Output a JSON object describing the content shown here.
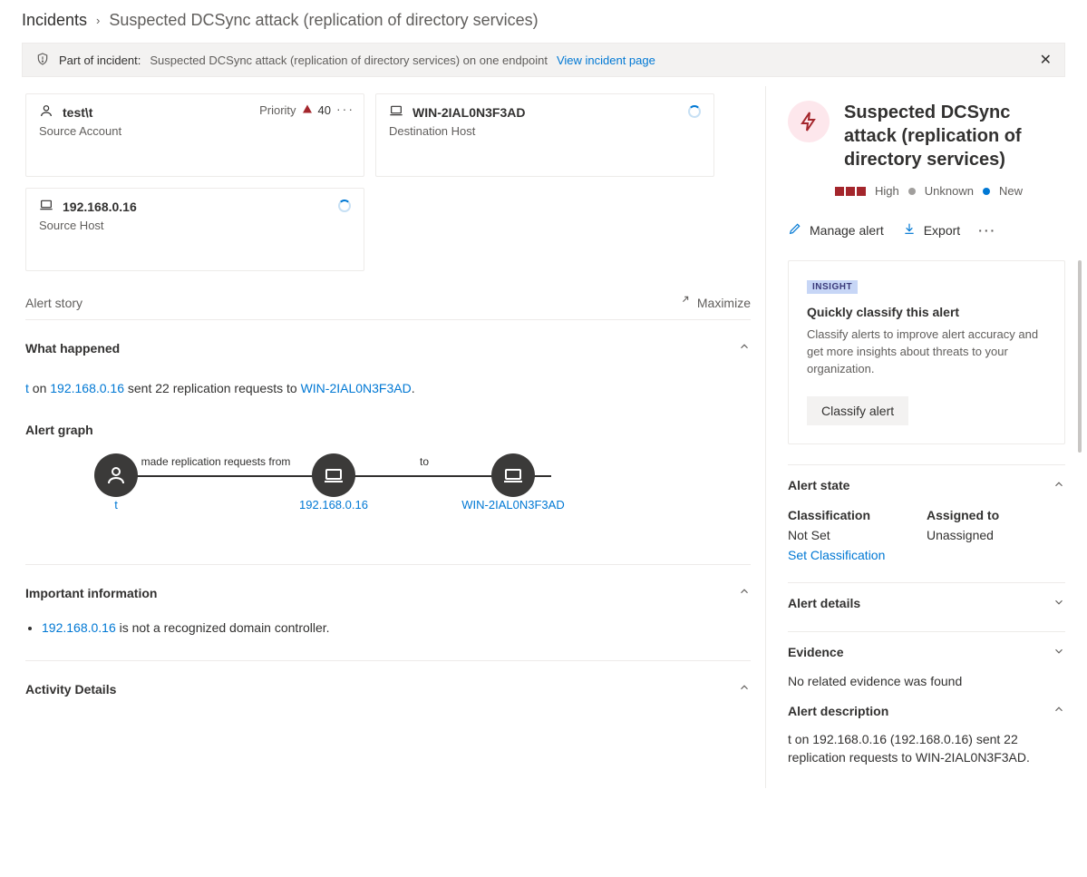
{
  "breadcrumb": {
    "root": "Incidents",
    "leaf": "Suspected DCSync attack (replication of directory services)"
  },
  "banner": {
    "prefix": "Part of incident:",
    "body": "Suspected DCSync attack (replication of directory services) on one endpoint",
    "link": "View incident page"
  },
  "cards": {
    "source_account": {
      "title": "test\\t",
      "subtitle": "Source Account",
      "priority_label": "Priority",
      "priority_value": "40"
    },
    "dest_host": {
      "title": "WIN-2IAL0N3F3AD",
      "subtitle": "Destination Host"
    },
    "source_host": {
      "title": "192.168.0.16",
      "subtitle": "Source Host"
    }
  },
  "alert_story": {
    "title": "Alert story",
    "maximize": "Maximize"
  },
  "what_happened": {
    "title": "What happened",
    "stmt": {
      "t1": "t",
      "t2": " on ",
      "ip": "192.168.0.16",
      "t3": " sent 22 replication requests to ",
      "host": "WIN-2IAL0N3F3AD",
      "t4": "."
    }
  },
  "alert_graph": {
    "title": "Alert graph",
    "nodes": {
      "n1": "t",
      "n2": "192.168.0.16",
      "n3": "WIN-2IAL0N3F3AD"
    },
    "edges": {
      "e1": "made replication requests from",
      "e2": "to"
    }
  },
  "important": {
    "title": "Important information",
    "items": [
      {
        "link": "192.168.0.16",
        "text": " is not a recognized domain controller."
      }
    ]
  },
  "activity_details": {
    "title": "Activity Details"
  },
  "side": {
    "title": "Suspected DCSync attack (replication of directory services)",
    "severity": "High",
    "state1": "Unknown",
    "state2": "New",
    "actions": {
      "manage": "Manage alert",
      "export": "Export"
    },
    "insight": {
      "tag": "INSIGHT",
      "title": "Quickly classify this alert",
      "body": "Classify alerts to improve alert accuracy and get more insights about threats to your organization.",
      "btn": "Classify alert"
    },
    "alert_state": {
      "title": "Alert state",
      "classification_label": "Classification",
      "classification_value": "Not Set",
      "set_link": "Set Classification",
      "assigned_label": "Assigned to",
      "assigned_value": "Unassigned"
    },
    "alert_details": {
      "title": "Alert details"
    },
    "evidence": {
      "title": "Evidence",
      "body": "No related evidence was found"
    },
    "alert_description": {
      "title": "Alert description",
      "body": "t on 192.168.0.16 (192.168.0.16) sent 22 replication requests to WIN-2IAL0N3F3AD."
    }
  }
}
